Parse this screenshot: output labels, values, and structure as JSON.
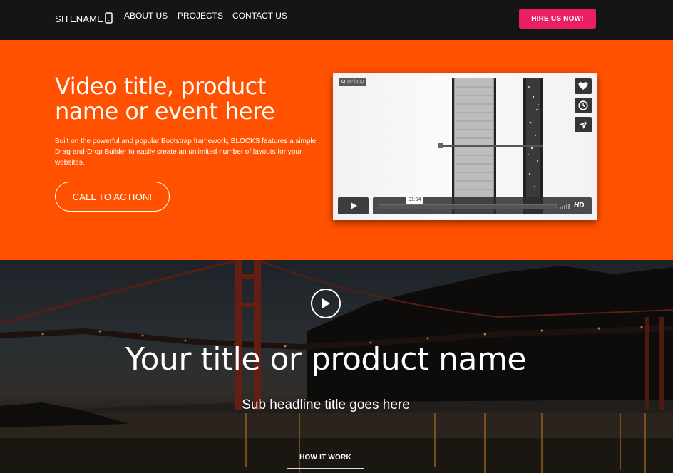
{
  "navbar": {
    "brand": "SITENAME",
    "links": [
      "ABOUT US",
      "PROJECTS",
      "CONTACT US"
    ],
    "hire_button": "HIRE US NOW!",
    "hire_color": "#e91e63"
  },
  "hero": {
    "background": "#ff5100",
    "title": "Video title, product name or event here",
    "description": "Built on the powerful and popular Bootstrap framework, BLOCKS features a simple Drag-and-Drop Builder to easily create an unlimited number of layouts for your websites.",
    "cta_label": "CALL TO ACTION!"
  },
  "video_player": {
    "tag": "or",
    "tag_faded": "pe lang",
    "time": "01:04",
    "hd_label": "HD",
    "side_icons": [
      "heart-icon",
      "clock-icon",
      "send-icon"
    ]
  },
  "bridge_section": {
    "title": "Your title or product name",
    "subtitle": "Sub headline title goes here",
    "button_label": "HOW IT WORK"
  }
}
